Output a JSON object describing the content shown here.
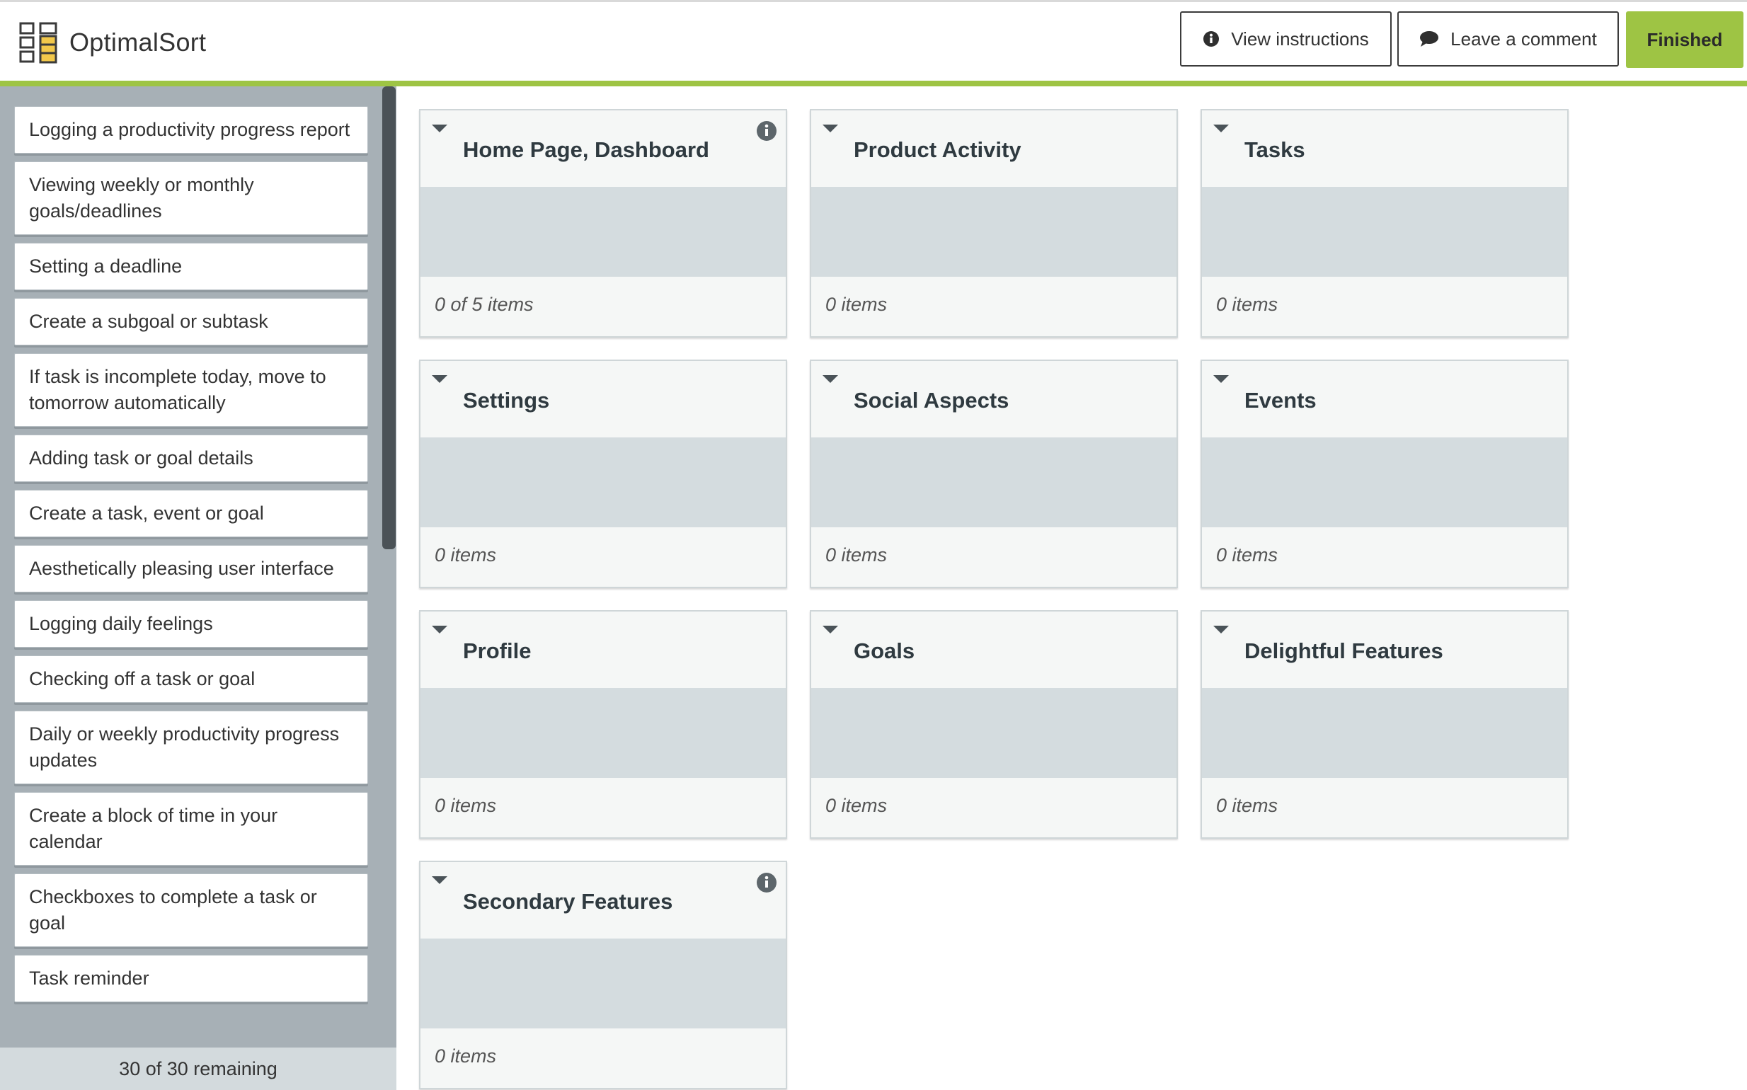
{
  "header": {
    "app_title": "OptimalSort",
    "logo_icon": "card-sort-logo-icon",
    "buttons": {
      "view_instructions": "View instructions",
      "leave_comment": "Leave a comment",
      "finished": "Finished"
    },
    "accent_color": "#9ec444"
  },
  "sidebar": {
    "cards": [
      "Logging a productivity progress report",
      "Viewing weekly or monthly goals/deadlines",
      "Setting a deadline",
      "Create a subgoal or subtask",
      "If task is incomplete today, move to tomorrow automatically",
      "Adding task or goal details",
      "Create a task, event or goal",
      "Aesthetically pleasing user interface",
      "Logging daily feelings",
      "Checking off a task or goal",
      "Daily or weekly productivity progress updates",
      "Create a block of time in your calendar",
      "Checkboxes to complete a task or goal",
      "Task reminder"
    ],
    "remaining": "30 of 30 remaining"
  },
  "categories": [
    {
      "title": "Home Page, Dashboard",
      "count": "0 of 5 items",
      "info_icon": true
    },
    {
      "title": "Product Activity",
      "count": "0 items",
      "info_icon": false
    },
    {
      "title": "Tasks",
      "count": "0 items",
      "info_icon": false
    },
    {
      "title": "Settings",
      "count": "0 items",
      "info_icon": false
    },
    {
      "title": "Social Aspects",
      "count": "0 items",
      "info_icon": false
    },
    {
      "title": "Events",
      "count": "0 items",
      "info_icon": false
    },
    {
      "title": "Profile",
      "count": "0 items",
      "info_icon": false
    },
    {
      "title": "Goals",
      "count": "0 items",
      "info_icon": false
    },
    {
      "title": "Delightful Features",
      "count": "0 items",
      "info_icon": false
    },
    {
      "title": "Secondary Features",
      "count": "0 items",
      "info_icon": true
    }
  ]
}
